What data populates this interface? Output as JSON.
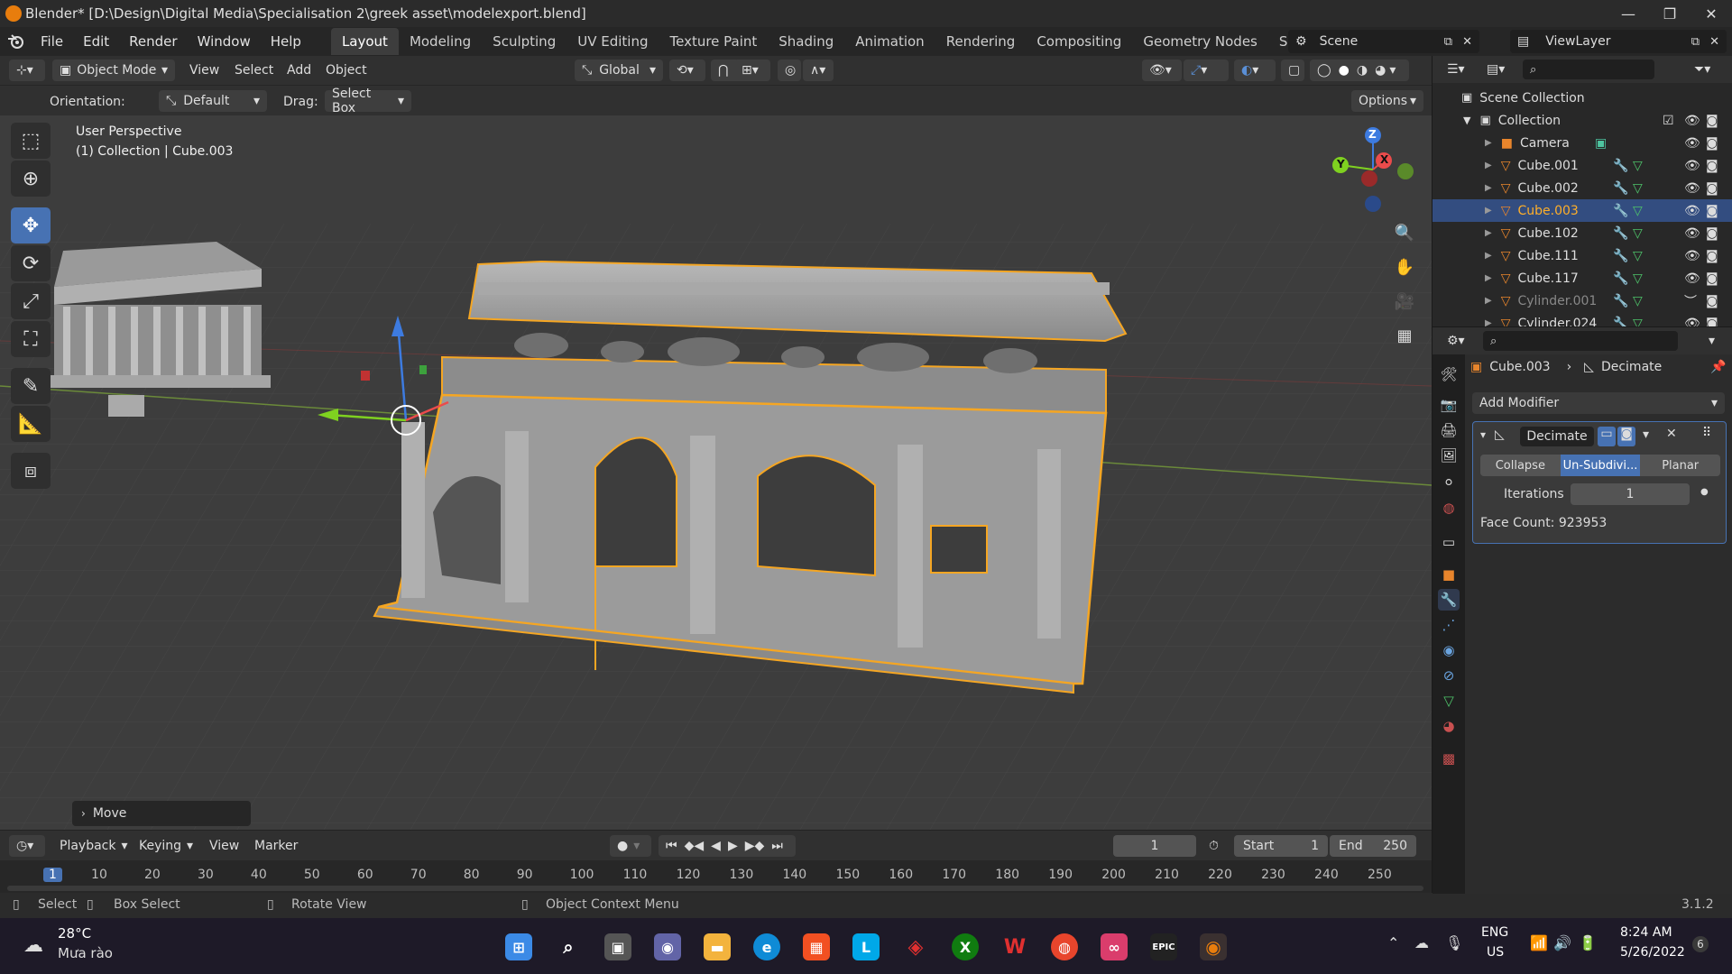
{
  "window": {
    "title": "Blender* [D:\\Design\\Digital Media\\Specialisation 2\\greek asset\\modelexport.blend]",
    "minimize": "—",
    "maximize": "❐",
    "close": "✕"
  },
  "menu": [
    "File",
    "Edit",
    "Render",
    "Window",
    "Help"
  ],
  "workspaces": [
    "Layout",
    "Modeling",
    "Sculpting",
    "UV Editing",
    "Texture Paint",
    "Shading",
    "Animation",
    "Rendering",
    "Compositing",
    "Geometry Nodes",
    "Scripting"
  ],
  "workspace_add": "+",
  "scene": "Scene",
  "view_layer": "ViewLayer",
  "viewport_header": {
    "mode": "Object Mode",
    "menus": [
      "View",
      "Select",
      "Add",
      "Object"
    ],
    "transform_orientation": "Global"
  },
  "tool_settings": {
    "orientation_label": "Orientation:",
    "orientation_value": "Default",
    "drag_label": "Drag:",
    "drag_value": "Select Box",
    "options": "Options"
  },
  "viewport": {
    "perspective": "User Perspective",
    "collection_info": "(1) Collection | Cube.003",
    "last_op": "Move",
    "gizmo": {
      "z": "Z",
      "y": "Y",
      "x": "X"
    }
  },
  "outliner": {
    "root": "Scene Collection",
    "collection": "Collection",
    "items": [
      {
        "name": "Camera",
        "selected": false,
        "dim": false
      },
      {
        "name": "Cube.001",
        "selected": false,
        "dim": false
      },
      {
        "name": "Cube.002",
        "selected": false,
        "dim": false
      },
      {
        "name": "Cube.003",
        "selected": true,
        "dim": false
      },
      {
        "name": "Cube.102",
        "selected": false,
        "dim": false
      },
      {
        "name": "Cube.111",
        "selected": false,
        "dim": false
      },
      {
        "name": "Cube.117",
        "selected": false,
        "dim": false
      },
      {
        "name": "Cylinder.001",
        "selected": false,
        "dim": true
      },
      {
        "name": "Cylinder.024",
        "selected": false,
        "dim": false
      }
    ]
  },
  "properties": {
    "breadcrumb_object": "Cube.003",
    "breadcrumb_modifier": "Decimate",
    "add_modifier": "Add Modifier",
    "modifier_name": "Decimate",
    "modes": [
      "Collapse",
      "Un-Subdivi...",
      "Planar"
    ],
    "active_mode": "Un-Subdivi...",
    "iterations_label": "Iterations",
    "iterations_value": "1",
    "face_count": "Face Count: 923953"
  },
  "timeline": {
    "menus": [
      "Playback",
      "Keying",
      "View",
      "Marker"
    ],
    "current_frame": "1",
    "start_label": "Start",
    "start_value": "1",
    "end_label": "End",
    "end_value": "250",
    "ticks": [
      "1",
      "10",
      "20",
      "30",
      "40",
      "50",
      "60",
      "70",
      "80",
      "90",
      "100",
      "110",
      "120",
      "130",
      "140",
      "150",
      "160",
      "170",
      "180",
      "190",
      "200",
      "210",
      "220",
      "230",
      "240",
      "250"
    ]
  },
  "statusbar": {
    "select": "Select",
    "box_select": "Box Select",
    "rotate_view": "Rotate View",
    "context_menu": "Object Context Menu",
    "version": "3.1.2"
  },
  "taskbar": {
    "weather_temp": "28°C",
    "weather_desc": "Mưa rào",
    "lang_top": "ENG",
    "lang_bottom": "US",
    "time": "8:24 AM",
    "date": "5/26/2022",
    "notifications": "6"
  },
  "colors": {
    "accent": "#4772b3",
    "selection_orange": "#f5a623",
    "outliner_selected": "#334d80"
  }
}
